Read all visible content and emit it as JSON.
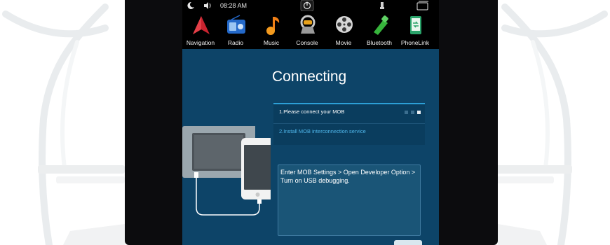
{
  "status_bar": {
    "time": "08:28 AM",
    "icons": [
      "night-mode-icon",
      "volume-icon",
      "power-icon",
      "usb-icon",
      "recent-apps-icon"
    ]
  },
  "apps": [
    {
      "label": "Navigation",
      "icon": "navigation-icon"
    },
    {
      "label": "Radio",
      "icon": "radio-icon"
    },
    {
      "label": "Music",
      "icon": "music-icon"
    },
    {
      "label": "Console",
      "icon": "console-icon"
    },
    {
      "label": "Movie",
      "icon": "movie-icon"
    },
    {
      "label": "Bluetooth",
      "icon": "bluetooth-icon"
    },
    {
      "label": "PhoneLink",
      "icon": "phonelink-icon"
    }
  ],
  "connect": {
    "title": "Connecting",
    "steps": [
      "1.Please connect your MOB",
      "2.Install MOB interconnection service"
    ],
    "instruction": "Enter MOB Settings > Open Developer Option > Turn on USB debugging.",
    "page_dots": {
      "count": 3,
      "active": 3
    }
  },
  "colors": {
    "panel_bg": "#0d4468",
    "accent": "#2c9fd6",
    "step_highlight": "#4fb6ea",
    "instruction_bg": "#1a5577"
  }
}
